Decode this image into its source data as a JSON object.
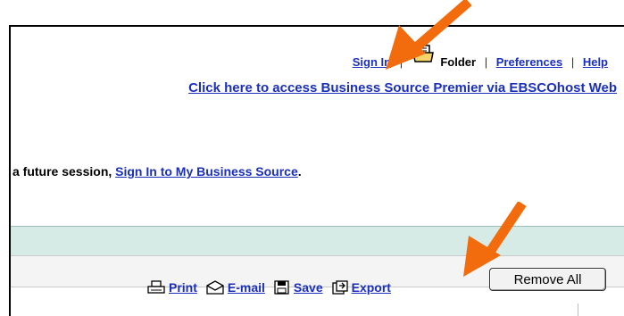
{
  "header": {
    "sign_in": "Sign In",
    "folder": "Folder",
    "preferences": "Preferences",
    "help": "Help",
    "separator": "|",
    "folder_icon": "folder-icon"
  },
  "access_link": "Click here to access Business Source Premier via EBSCOhost Web",
  "session": {
    "prefix": "a future session, ",
    "link": "Sign In to My Business Source",
    "suffix": "."
  },
  "toolbar": {
    "print": "Print",
    "email": "E-mail",
    "save": "Save",
    "export": "Export",
    "remove_all": "Remove All"
  },
  "colors": {
    "link": "#1a2fbd",
    "annotation_arrow": "#f26c0d",
    "band": "#d7ebe6"
  }
}
